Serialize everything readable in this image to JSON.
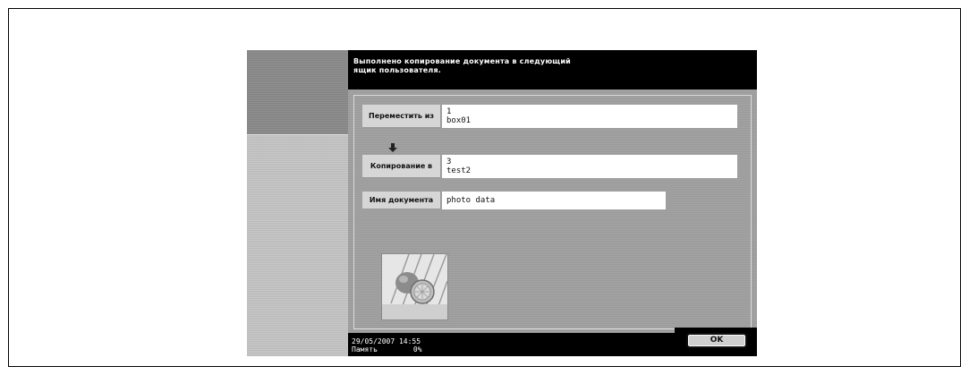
{
  "message": {
    "line1": "Выполнено копирование документа в следующий",
    "line2": "ящик пользователя."
  },
  "fields": {
    "move_from": {
      "label": "Переместить из",
      "number": "1",
      "name": "box01"
    },
    "copy_to": {
      "label": "Копирование в",
      "number": "3",
      "name": "test2"
    },
    "document_name": {
      "label": "Имя документа",
      "value": "photo data"
    }
  },
  "thumbnail": {
    "icon": "document-thumbnail-oranges"
  },
  "footer": {
    "date_time": "29/05/2007   14:55",
    "memory_label": "Память",
    "memory_value": "0%"
  },
  "buttons": {
    "ok": "OK"
  },
  "icons": {
    "arrow": "arrow-down-icon"
  }
}
